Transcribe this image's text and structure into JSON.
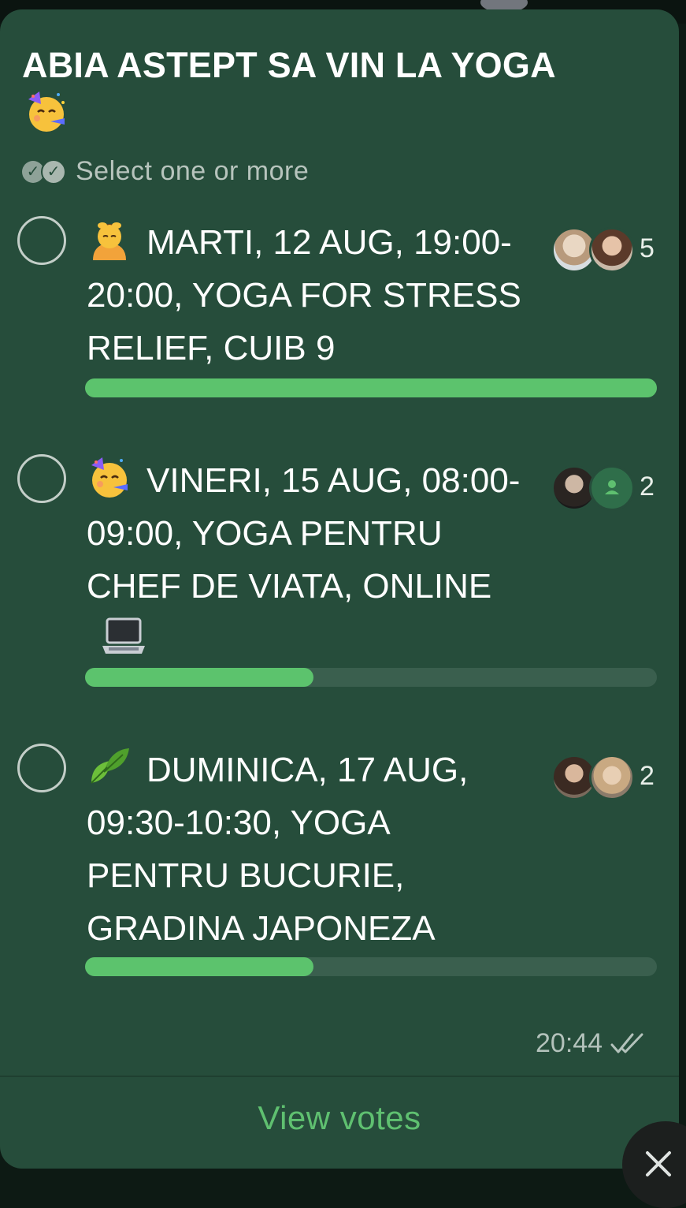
{
  "poll": {
    "title": "ABIA ASTEPT SA VIN LA YOGA",
    "title_icon": "partying-face-icon",
    "mode_label": "Select one or more",
    "options": [
      {
        "icon": "face-massage-icon",
        "text": "MARTI, 12 AUG, 19:00-20:00, YOGA FOR STRESS RELIEF, CUIB 9",
        "votes": "5",
        "fill_fraction": 1.0
      },
      {
        "icon": "partying-face-icon",
        "text": "VINERI, 15 AUG, 08:00-09:00, YOGA PENTRU CHEF DE VIATA, ONLINE",
        "trailing_icon": "laptop-icon",
        "votes": "2",
        "fill_fraction": 0.4
      },
      {
        "icon": "leaf-icon",
        "text": "DUMINICA, 17 AUG, 09:30-10:30, YOGA PENTRU BUCURIE, GRADINA JAPONEZA",
        "votes": "2",
        "fill_fraction": 0.4
      }
    ],
    "time": "20:44",
    "read_status_icon": "double-check-icon",
    "view_votes_label": "View votes"
  },
  "colors": {
    "bubble": "#264d3b",
    "bar_fill": "#5cc36d",
    "bar_track": "#3a5f4e",
    "accent_link": "#5fc070"
  }
}
